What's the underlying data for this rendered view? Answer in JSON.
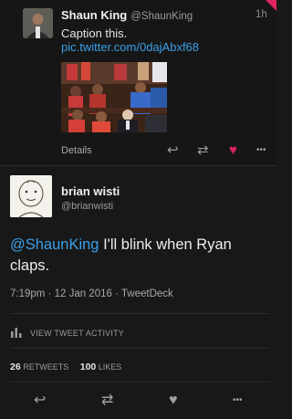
{
  "tweet1": {
    "name": "Shaun King",
    "handle": "@ShaunKing",
    "time": "1h",
    "text": "Caption this.",
    "link": "pic.twitter.com/0dajAbxf68",
    "details_label": "Details"
  },
  "tweet2": {
    "name": "brian wisti",
    "handle": "@brianwisti",
    "mention": "@ShaunKing",
    "text_rest": " I'll blink when Ryan claps.",
    "meta": "7:19pm · 12 Jan 2016 · TweetDeck",
    "view_activity": "VIEW TWEET ACTIVITY",
    "retweets_count": "26",
    "retweets_label": "RETWEETS",
    "likes_count": "100",
    "likes_label": "LIKES"
  },
  "icons": {
    "reply": "↩",
    "retweet": "⇄",
    "like_filled": "♥",
    "like": "♥",
    "more": "•••"
  },
  "colors": {
    "background": "#181818",
    "link": "#3b9fe8",
    "liked": "#e0245e",
    "muted": "#9a9a9a"
  }
}
